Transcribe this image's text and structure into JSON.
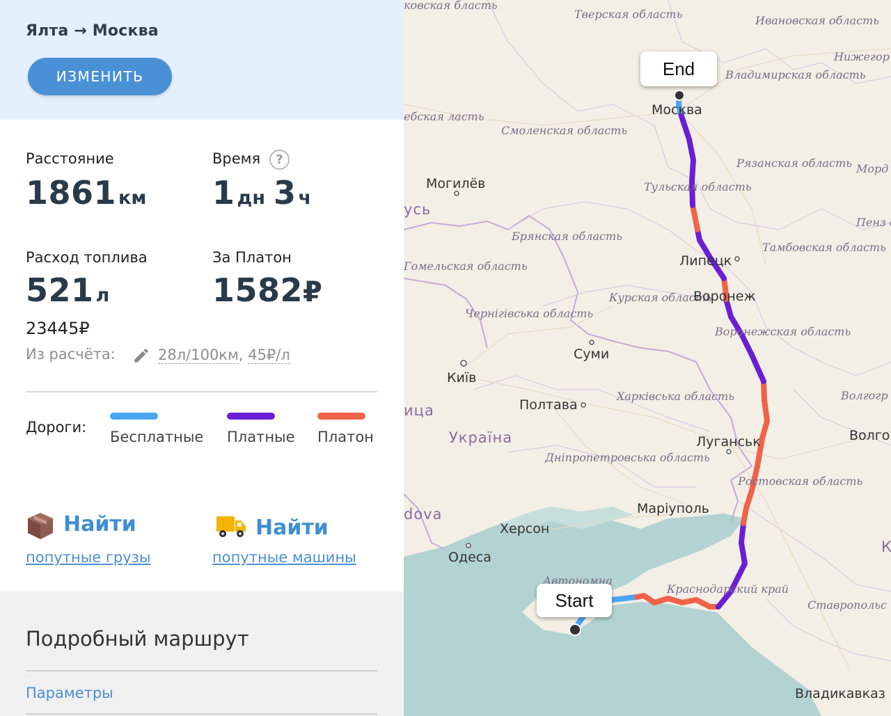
{
  "header": {
    "route_title": "Ялта → Москва",
    "edit_button": "ИЗМЕНИТЬ"
  },
  "stats": {
    "distance": {
      "label": "Расстояние",
      "value": "1861",
      "unit": "км"
    },
    "time": {
      "label": "Время",
      "days": "1",
      "days_unit": "дн",
      "hours": "3",
      "hours_unit": "ч",
      "help_icon": "?"
    },
    "fuel": {
      "label": "Расход топлива",
      "value": "521",
      "unit": "л",
      "cost": "23445₽"
    },
    "platon": {
      "label": "За Платон",
      "value": "1582",
      "unit": "₽"
    }
  },
  "calc": {
    "label": "Из расчёта:",
    "consumption": "28л/100км",
    "separator": ",",
    "price": "45₽/л"
  },
  "roads": {
    "label": "Дороги:",
    "legend": [
      {
        "name": "Бесплатные",
        "color": "#4aa6f0"
      },
      {
        "name": "Платные",
        "color": "#6a1fd6"
      },
      {
        "name": "Платон",
        "color": "#f0624a"
      }
    ]
  },
  "find": {
    "cargo": {
      "title": "Найти",
      "link": "попутные грузы",
      "icon": "box-icon"
    },
    "cars": {
      "title": "Найти",
      "link": "попутные машины",
      "icon": "truck-icon"
    }
  },
  "details": {
    "title": "Подробный маршрут",
    "params_link": "Параметры"
  },
  "map": {
    "start_label": "Start",
    "end_label": "End",
    "cities": [
      "Москва",
      "Могилёв",
      "Липецк",
      "Воронеж",
      "Суми",
      "Київ",
      "Полтава",
      "Луганськ",
      "Маріуполь",
      "Херсон",
      "Одеса",
      "Владикавказ",
      "Волго"
    ],
    "regions": [
      "Тверская область",
      "Ивановская область",
      "Нижегор облас",
      "Владимирская область",
      "Смоленская область",
      "Рязанская область",
      "Морд",
      "Тульская область",
      "Брянская область",
      "Тамбовская область",
      "Пенз обл",
      "Гомельская область",
      "Курская область",
      "Чернігівська область",
      "Воронежская область",
      "Харківська область",
      "Волгогр обл",
      "Дніпропетровська область",
      "Ростовская область",
      "Краснодарский край",
      "Ставропольс край",
      "Автономна",
      "ебская ласть",
      "ковская бласть"
    ],
    "countries": [
      "Україна",
      "усь",
      "dova",
      "ица",
      "К"
    ],
    "colors": {
      "free": "#4aa6f0",
      "toll": "#6a1fd6",
      "platon": "#f0624a",
      "sea": "#b3d3d2",
      "land": "#f3efe6"
    }
  }
}
